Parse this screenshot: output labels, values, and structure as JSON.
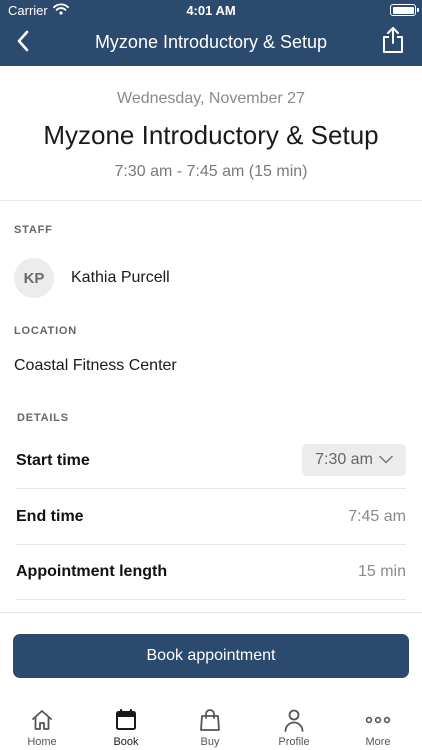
{
  "status_bar": {
    "carrier": "Carrier",
    "time": "4:01 AM"
  },
  "nav": {
    "title": "Myzone Introductory & Setup"
  },
  "summary": {
    "date": "Wednesday, November 27",
    "title": "Myzone Introductory & Setup",
    "time_range": "7:30 am - 7:45 am (15 min)"
  },
  "staff": {
    "section_label": "STAFF",
    "initials": "KP",
    "name": "Kathia Purcell"
  },
  "location": {
    "section_label": "LOCATION",
    "name": "Coastal Fitness Center"
  },
  "details": {
    "section_label": "DETAILS",
    "start_time_label": "Start time",
    "start_time_value": "7:30 am",
    "end_time_label": "End time",
    "end_time_value": "7:45 am",
    "length_label": "Appointment length",
    "length_value": "15 min"
  },
  "book_button": {
    "label": "Book appointment"
  },
  "tabs": [
    {
      "label": "Home",
      "icon": "home-icon"
    },
    {
      "label": "Book",
      "icon": "calendar-icon"
    },
    {
      "label": "Buy",
      "icon": "shopping-bag-icon"
    },
    {
      "label": "Profile",
      "icon": "person-icon"
    },
    {
      "label": "More",
      "icon": "more-dots-icon"
    }
  ],
  "colors": {
    "brand": "#2c4a6e",
    "active_tab": "Book"
  }
}
